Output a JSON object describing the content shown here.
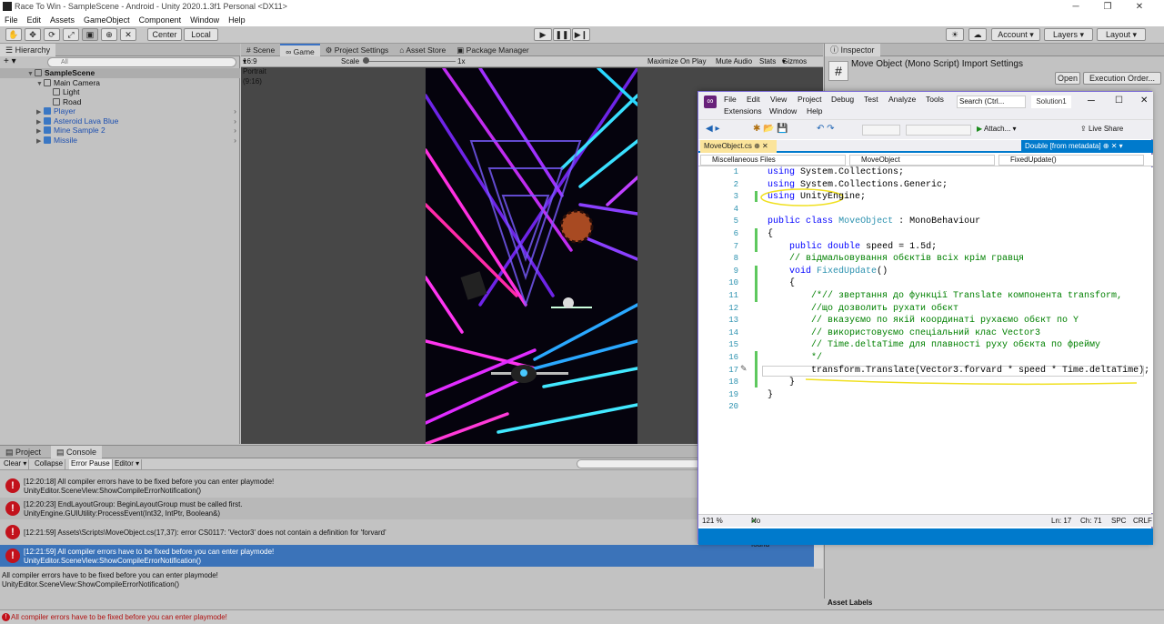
{
  "window": {
    "title": "Race To Win - SampleScene - Android - Unity 2020.1.3f1 Personal <DX11>"
  },
  "menu": [
    "File",
    "Edit",
    "Assets",
    "GameObject",
    "Component",
    "Window",
    "Help"
  ],
  "toolbar": {
    "center": "Center",
    "local": "Local",
    "account": "Account",
    "layers": "Layers",
    "layout": "Layout"
  },
  "hierarchy": {
    "tab": "Hierarchy",
    "search_placeholder": "All",
    "items": [
      {
        "label": "SampleScene",
        "depth": 0,
        "kind": "scene"
      },
      {
        "label": "Main Camera",
        "depth": 1,
        "kind": "go"
      },
      {
        "label": "Light",
        "depth": 2,
        "kind": "go"
      },
      {
        "label": "Road",
        "depth": 2,
        "kind": "go"
      },
      {
        "label": "Player",
        "depth": 1,
        "kind": "prefab"
      },
      {
        "label": "Asteroid Lava Blue",
        "depth": 1,
        "kind": "prefab"
      },
      {
        "label": "Mine Sample 2",
        "depth": 1,
        "kind": "prefab"
      },
      {
        "label": "Missile",
        "depth": 1,
        "kind": "prefab"
      }
    ]
  },
  "center": {
    "tabs": [
      "Scene",
      "Game",
      "Project Settings",
      "Asset Store",
      "Package Manager"
    ],
    "aspect": "16:9 Portrait (9:16)",
    "scale_label": "Scale",
    "scale_value": "1x",
    "maximize": "Maximize On Play",
    "mute": "Mute Audio",
    "stats": "Stats",
    "gizmos": "Gizmos"
  },
  "inspector": {
    "tab": "Inspector",
    "title": "Move Object (Mono Script) Import Settings",
    "open": "Open",
    "exec": "Execution Order...",
    "asset_labels": "Asset Labels"
  },
  "console": {
    "tabs": [
      "Project",
      "Console"
    ],
    "buttons": [
      "Clear",
      "Collapse",
      "Error Pause",
      "Editor"
    ],
    "rows": [
      {
        "l1": "[12:20:18] All compiler errors have to be fixed before you can enter playmode!",
        "l2": "UnityEditor.SceneView:ShowCompileErrorNotification()"
      },
      {
        "l1": "[12:20:23] EndLayoutGroup: BeginLayoutGroup must be called first.",
        "l2": "UnityEngine.GUIUtility:ProcessEvent(Int32, IntPtr, Boolean&)"
      },
      {
        "l1": "[12:21:59] Assets\\Scripts\\MoveObject.cs(17,37): error CS0117: 'Vector3' does not contain a definition for 'forvard'",
        "l2": ""
      },
      {
        "l1": "[12:21:59] All compiler errors have to be fixed before you can enter playmode!",
        "l2": "UnityEditor.SceneView:ShowCompileErrorNotification()"
      }
    ],
    "detail1": "All compiler errors have to be fixed before you can enter playmode!",
    "detail2": "UnityEditor.SceneView:ShowCompileErrorNotification()"
  },
  "statusbar": "All compiler errors have to be fixed before you can enter playmode!",
  "vs": {
    "menu1": [
      "File",
      "Edit",
      "View",
      "Project",
      "Debug",
      "Test",
      "Analyze",
      "Tools"
    ],
    "menu2": [
      "Extensions",
      "Window",
      "Help"
    ],
    "search": "Search (Ctrl...",
    "solution": "Solution1",
    "attach": "Attach...",
    "liveshare": "Live Share",
    "doctab": "MoveObject.cs",
    "meta": "Double [from metadata]",
    "nav": [
      "Miscellaneous Files",
      "MoveObject",
      "FixedUpdate()"
    ],
    "lines": [
      "using System.Collections;",
      "using System.Collections.Generic;",
      "using UnityEngine;",
      "",
      "public class MoveObject : MonoBehaviour",
      "{",
      "    public double speed = 1.5d;",
      "    // відмальовування обєктів всіх крім гравця",
      "    void FixedUpdate()",
      "    {",
      "        /*// звертання до функції Translate компонента transform,",
      "        //що дозволить рухати обєкт",
      "        // вказуємо по якій координаті рухаємо обєкт по Y",
      "        // використовуємо спеціальний клас Vector3",
      "        // Time.deltaTime для плавності руху обєкта по фрейму",
      "        */",
      "        transform.Translate(Vector3.forvard * speed * Time.deltaTime);",
      "    }",
      "}",
      ""
    ],
    "zoom": "121 %",
    "issues": "No issues found",
    "ln": "Ln: 17",
    "ch": "Ch: 71",
    "spc": "SPC",
    "crlf": "CRLF"
  }
}
